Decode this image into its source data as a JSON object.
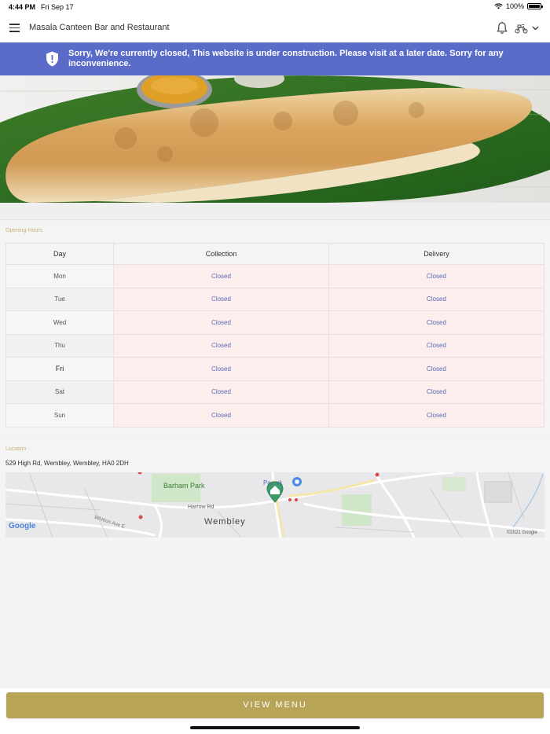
{
  "status_bar": {
    "time": "4:44 PM",
    "date": "Fri Sep 17",
    "battery": "100%",
    "battery_level": 1.0
  },
  "header": {
    "title": "Masala Canteen Bar and Restaurant",
    "icons": [
      "menu-icon",
      "bell-icon",
      "scooter-icon",
      "chevron-down-icon"
    ]
  },
  "banner": {
    "text": "Sorry, We're currently closed, This website is under construction. Please visit at a later date. Sorry for any inconvenience.",
    "icon": "shield-icon",
    "color": "#5b6cc8"
  },
  "opening_hours": {
    "label": "Opening Hours",
    "headers": {
      "day": "Day",
      "collection": "Collection",
      "delivery": "Delivery"
    },
    "rows": [
      {
        "day": "Mon",
        "collection": "Closed",
        "delivery": "Closed"
      },
      {
        "day": "Tue",
        "collection": "Closed",
        "delivery": "Closed"
      },
      {
        "day": "Wed",
        "collection": "Closed",
        "delivery": "Closed"
      },
      {
        "day": "Thu",
        "collection": "Closed",
        "delivery": "Closed"
      },
      {
        "day": "Fri",
        "collection": "Closed",
        "delivery": "Closed"
      },
      {
        "day": "Sat",
        "collection": "Closed",
        "delivery": "Closed"
      },
      {
        "day": "Sun",
        "collection": "Closed",
        "delivery": "Closed"
      }
    ]
  },
  "location": {
    "label": "Location",
    "address": "529 High Rd, Wembley, Wembley, HA0 2DH",
    "map": {
      "area_label": "Wembley",
      "park_label": "Barham Park",
      "road_label": "Harrow Rd",
      "road_label_2": "Whitton Ave E",
      "poi_label": "Pa…rk",
      "brand": "Google",
      "copyright": "©2021 Google"
    }
  },
  "footer": {
    "view_menu_label": "VIEW MENU"
  },
  "colors": {
    "accent": "#b7a456",
    "closed_cell": "#fdeeee",
    "closed_text": "#5a6ab8",
    "section_label": "#c8b27a"
  }
}
